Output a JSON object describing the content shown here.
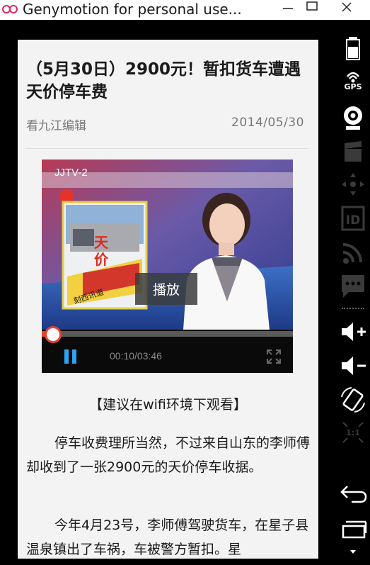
{
  "window": {
    "title": "Genymotion for personal use..."
  },
  "sidebar": {
    "items": [
      {
        "name": "battery-icon"
      },
      {
        "name": "gps-icon",
        "label": "GPS"
      },
      {
        "name": "webcam-icon"
      },
      {
        "name": "clapperboard-icon"
      },
      {
        "name": "dpad-icon"
      },
      {
        "name": "id-icon",
        "label": "ID"
      },
      {
        "name": "rss-icon"
      },
      {
        "name": "sms-icon"
      },
      {
        "name": "volume-up-icon"
      },
      {
        "name": "volume-down-icon"
      },
      {
        "name": "rotate-icon"
      },
      {
        "name": "pixel-perfect-icon",
        "label": "1:1"
      },
      {
        "name": "back-icon"
      },
      {
        "name": "recent-apps-icon"
      }
    ]
  },
  "article": {
    "title": "（5月30日）2900元！暂扣货车遭遇天价停车费",
    "source": "看九江编辑",
    "date": "2014/05/30",
    "notice": "【建议在wifi环境下观看】",
    "paragraphs": [
      "停车收费理所当然，不过来自山东的李师傅却收到了一张2900元的天价停车收据。",
      "今年4月23号，李师傅驾驶货车，在星子县温泉镇出了车祸，车被警方暂扣。星"
    ]
  },
  "player": {
    "channel": "JJTV-2",
    "overlay_label": "播放",
    "time": "00:10/03:46",
    "progress": 0.044,
    "accent_color": "#e8412f",
    "pause_color": "#2ea3f2",
    "banner_chars": [
      "天",
      "价"
    ],
    "banner_caption": "刻西讯道"
  }
}
